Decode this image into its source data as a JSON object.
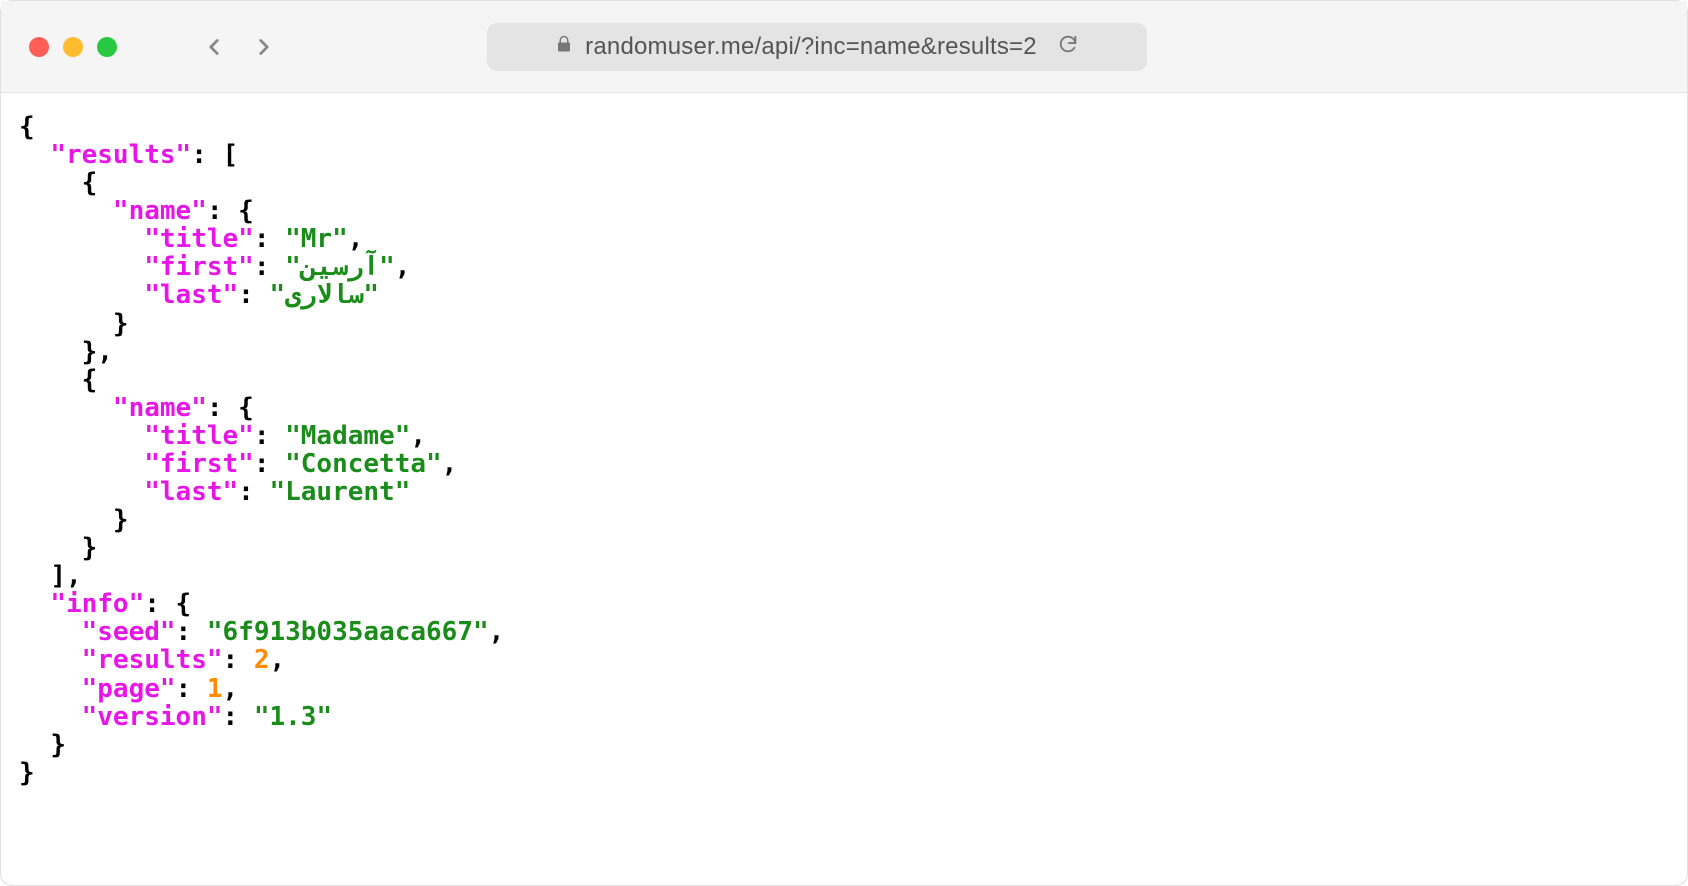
{
  "browser": {
    "url": "randomuser.me/api/?inc=name&results=2"
  },
  "json": {
    "keys": {
      "results": "\"results\"",
      "name": "\"name\"",
      "title": "\"title\"",
      "first": "\"first\"",
      "last": "\"last\"",
      "info": "\"info\"",
      "seed": "\"seed\"",
      "page": "\"page\"",
      "version": "\"version\""
    },
    "results": [
      {
        "name": {
          "title": "\"Mr\"",
          "first": "\"آرسین\"",
          "last": "\"سالاری\""
        }
      },
      {
        "name": {
          "title": "\"Madame\"",
          "first": "\"Concetta\"",
          "last": "\"Laurent\""
        }
      }
    ],
    "info": {
      "seed": "\"6f913b035aaca667\"",
      "results": "2",
      "page": "1",
      "version": "\"1.3\""
    }
  }
}
